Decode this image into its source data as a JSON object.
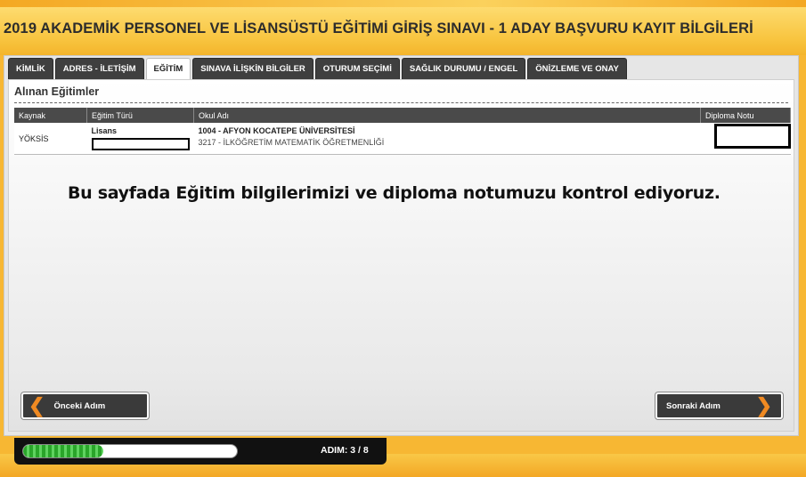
{
  "header": {
    "title": "2019 AKADEMİK PERSONEL VE LİSANSÜSTÜ EĞİTİMİ GİRİŞ SINAVI - 1 ADAY BAŞVURU KAYIT BİLGİLERİ"
  },
  "tabs": [
    {
      "label": "KİMLİK"
    },
    {
      "label": "ADRES - İLETİŞİM"
    },
    {
      "label": "EĞİTİM",
      "active": true
    },
    {
      "label": "SINAVA İLİŞKİN BİLGİLER"
    },
    {
      "label": "OTURUM SEÇİMİ"
    },
    {
      "label": "SAĞLIK DURUMU / ENGEL"
    },
    {
      "label": "ÖNİZLEME VE ONAY"
    }
  ],
  "section": {
    "title": "Alınan Eğitimler"
  },
  "table": {
    "headers": [
      "Kaynak",
      "Eğitim Türü",
      "Okul Adı",
      "Diploma Notu"
    ],
    "rows": [
      {
        "source": "YÖKSİS",
        "education_type": "Lisans",
        "school": "1004 - AFYON KOCATEPE ÜNİVERSİTESİ",
        "department": "3217 - İLKÖĞRETİM MATEMATİK ÖĞRETMENLİĞİ"
      }
    ]
  },
  "notice": "Bu sayfada Eğitim bilgilerimizi ve diploma notumuzu kontrol ediyoruz.",
  "nav": {
    "prev_label": "Önceki Adım",
    "next_label": "Sonraki Adım"
  },
  "progress": {
    "label": "ADIM:",
    "value": "3 / 8",
    "fraction": 0.375
  },
  "colors": {
    "accent": "#f7b733",
    "tab_dark": "#3f3f3f",
    "chevron": "#f08a22",
    "progress": "#2aa52a"
  }
}
